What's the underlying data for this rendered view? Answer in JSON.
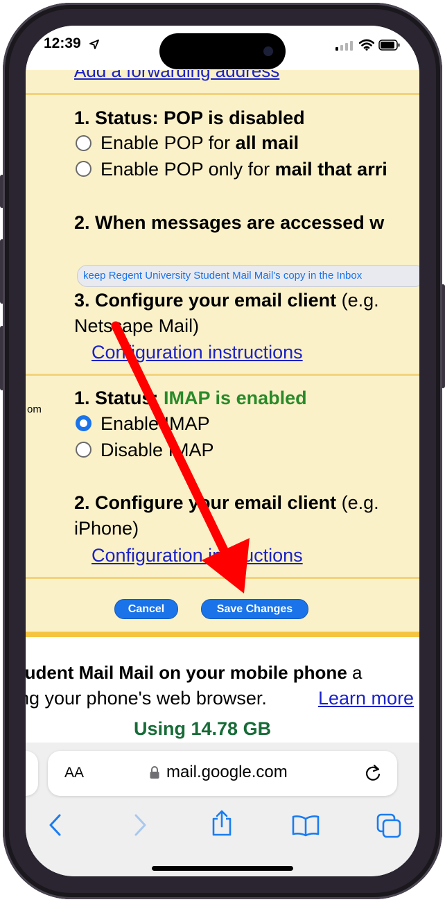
{
  "status_bar": {
    "time": "12:39"
  },
  "page": {
    "forwarding_link": "Add a forwarding address",
    "pop": {
      "status_prefix": "1. Status: ",
      "status_value": "POP is disabled",
      "option1_prefix": "Enable POP for ",
      "option1_bold": "all mail",
      "option2_prefix": "Enable POP only for ",
      "option2_bold": "mail that arri",
      "access_heading": "2. When messages are accessed w",
      "access_select": "keep Regent University Student Mail Mail's copy in the Inbox",
      "configure_heading": "3. Configure your email client",
      "configure_rest": " (e.g.",
      "configure_line2": "Netscape Mail)",
      "config_link": "Configuration instructions"
    },
    "left_fragment": "om",
    "imap": {
      "status_prefix": "1. Status: ",
      "status_value": "IMAP is enabled",
      "enable_label": "Enable IMAP",
      "disable_label": "Disable IMAP",
      "configure_heading": "2. Configure your email client",
      "configure_rest": " (e.g.",
      "configure_line2": "iPhone)",
      "config_link": "Configuration instructions"
    },
    "buttons": {
      "cancel": "Cancel",
      "save": "Save Changes"
    },
    "footer": {
      "mobile_line1": "tudent Mail Mail on your mobile phone",
      "mobile_line1_tail": " a",
      "mobile_line2": "ng your phone's web browser.",
      "learn_more": "Learn more",
      "storage": "Using 14.78 GB"
    }
  },
  "browser": {
    "aa_label": "AA",
    "url": "mail.google.com"
  },
  "colors": {
    "accent": "#1a73e8",
    "enabled_green": "#2a8a2a",
    "storage_green": "#176b37",
    "panel_yellow": "#fbf1c9",
    "annotation_red": "#ff0000"
  }
}
